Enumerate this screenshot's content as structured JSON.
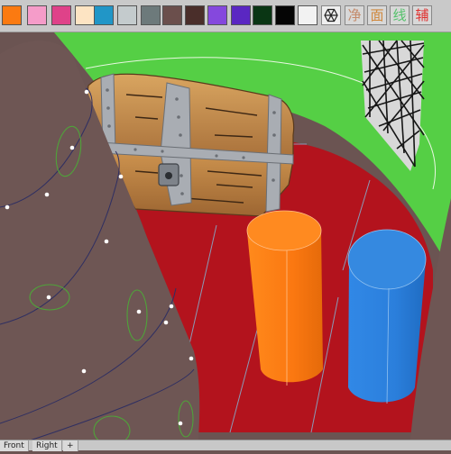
{
  "toolbar": {
    "swatches": [
      {
        "name": "orange",
        "color": "#fb7a11"
      },
      {
        "name": "pink",
        "color": "#f59cc9"
      },
      {
        "name": "magenta",
        "color": "#df4289"
      },
      {
        "name": "cream",
        "color": "#fde4c3"
      },
      {
        "name": "blue",
        "color": "#2196c7"
      },
      {
        "name": "light-gray",
        "color": "#c4cbcd"
      },
      {
        "name": "slate-gray",
        "color": "#6d7a7b"
      },
      {
        "name": "brown",
        "color": "#6b4f4c"
      },
      {
        "name": "dark-brown",
        "color": "#4a2e2a"
      },
      {
        "name": "violet",
        "color": "#8548dd"
      },
      {
        "name": "indigo",
        "color": "#5a27c2"
      },
      {
        "name": "dark-green",
        "color": "#0a3614"
      },
      {
        "name": "black",
        "color": "#050505"
      },
      {
        "name": "white",
        "color": "#f2f2f2"
      }
    ],
    "buttons": [
      {
        "name": "jing-button",
        "label": "净",
        "color": "#c48a6a"
      },
      {
        "name": "mian-button",
        "label": "面",
        "color": "#d0883c"
      },
      {
        "name": "xian-button",
        "label": "线",
        "color": "#55c26c"
      },
      {
        "name": "fu-button",
        "label": "辅",
        "color": "#e0312f"
      }
    ]
  },
  "scene": {
    "colors": {
      "background": "#6b5452",
      "grass": "#55cf45",
      "floor": "#b3131d",
      "orange_cylinder": "#fb7811",
      "blue_cylinder": "#2b7fdc",
      "chest_wood": "#c18a4a",
      "chest_metal": "#a9adb3",
      "cone": "#6e5654"
    }
  },
  "tabs": [
    {
      "name": "tab-front",
      "label": "Front"
    },
    {
      "name": "tab-right",
      "label": "Right"
    },
    {
      "name": "tab-add",
      "label": "+"
    }
  ]
}
